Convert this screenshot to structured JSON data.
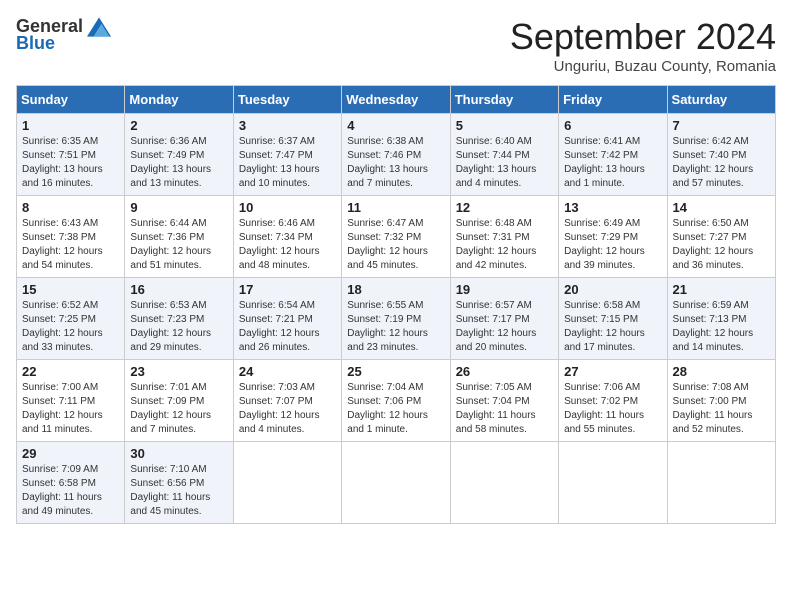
{
  "header": {
    "logo_general": "General",
    "logo_blue": "Blue",
    "month_title": "September 2024",
    "subtitle": "Unguriu, Buzau County, Romania"
  },
  "columns": [
    "Sunday",
    "Monday",
    "Tuesday",
    "Wednesday",
    "Thursday",
    "Friday",
    "Saturday"
  ],
  "weeks": [
    [
      {
        "day": "1",
        "sunrise": "Sunrise: 6:35 AM",
        "sunset": "Sunset: 7:51 PM",
        "daylight": "Daylight: 13 hours and 16 minutes."
      },
      {
        "day": "2",
        "sunrise": "Sunrise: 6:36 AM",
        "sunset": "Sunset: 7:49 PM",
        "daylight": "Daylight: 13 hours and 13 minutes."
      },
      {
        "day": "3",
        "sunrise": "Sunrise: 6:37 AM",
        "sunset": "Sunset: 7:47 PM",
        "daylight": "Daylight: 13 hours and 10 minutes."
      },
      {
        "day": "4",
        "sunrise": "Sunrise: 6:38 AM",
        "sunset": "Sunset: 7:46 PM",
        "daylight": "Daylight: 13 hours and 7 minutes."
      },
      {
        "day": "5",
        "sunrise": "Sunrise: 6:40 AM",
        "sunset": "Sunset: 7:44 PM",
        "daylight": "Daylight: 13 hours and 4 minutes."
      },
      {
        "day": "6",
        "sunrise": "Sunrise: 6:41 AM",
        "sunset": "Sunset: 7:42 PM",
        "daylight": "Daylight: 13 hours and 1 minute."
      },
      {
        "day": "7",
        "sunrise": "Sunrise: 6:42 AM",
        "sunset": "Sunset: 7:40 PM",
        "daylight": "Daylight: 12 hours and 57 minutes."
      }
    ],
    [
      {
        "day": "8",
        "sunrise": "Sunrise: 6:43 AM",
        "sunset": "Sunset: 7:38 PM",
        "daylight": "Daylight: 12 hours and 54 minutes."
      },
      {
        "day": "9",
        "sunrise": "Sunrise: 6:44 AM",
        "sunset": "Sunset: 7:36 PM",
        "daylight": "Daylight: 12 hours and 51 minutes."
      },
      {
        "day": "10",
        "sunrise": "Sunrise: 6:46 AM",
        "sunset": "Sunset: 7:34 PM",
        "daylight": "Daylight: 12 hours and 48 minutes."
      },
      {
        "day": "11",
        "sunrise": "Sunrise: 6:47 AM",
        "sunset": "Sunset: 7:32 PM",
        "daylight": "Daylight: 12 hours and 45 minutes."
      },
      {
        "day": "12",
        "sunrise": "Sunrise: 6:48 AM",
        "sunset": "Sunset: 7:31 PM",
        "daylight": "Daylight: 12 hours and 42 minutes."
      },
      {
        "day": "13",
        "sunrise": "Sunrise: 6:49 AM",
        "sunset": "Sunset: 7:29 PM",
        "daylight": "Daylight: 12 hours and 39 minutes."
      },
      {
        "day": "14",
        "sunrise": "Sunrise: 6:50 AM",
        "sunset": "Sunset: 7:27 PM",
        "daylight": "Daylight: 12 hours and 36 minutes."
      }
    ],
    [
      {
        "day": "15",
        "sunrise": "Sunrise: 6:52 AM",
        "sunset": "Sunset: 7:25 PM",
        "daylight": "Daylight: 12 hours and 33 minutes."
      },
      {
        "day": "16",
        "sunrise": "Sunrise: 6:53 AM",
        "sunset": "Sunset: 7:23 PM",
        "daylight": "Daylight: 12 hours and 29 minutes."
      },
      {
        "day": "17",
        "sunrise": "Sunrise: 6:54 AM",
        "sunset": "Sunset: 7:21 PM",
        "daylight": "Daylight: 12 hours and 26 minutes."
      },
      {
        "day": "18",
        "sunrise": "Sunrise: 6:55 AM",
        "sunset": "Sunset: 7:19 PM",
        "daylight": "Daylight: 12 hours and 23 minutes."
      },
      {
        "day": "19",
        "sunrise": "Sunrise: 6:57 AM",
        "sunset": "Sunset: 7:17 PM",
        "daylight": "Daylight: 12 hours and 20 minutes."
      },
      {
        "day": "20",
        "sunrise": "Sunrise: 6:58 AM",
        "sunset": "Sunset: 7:15 PM",
        "daylight": "Daylight: 12 hours and 17 minutes."
      },
      {
        "day": "21",
        "sunrise": "Sunrise: 6:59 AM",
        "sunset": "Sunset: 7:13 PM",
        "daylight": "Daylight: 12 hours and 14 minutes."
      }
    ],
    [
      {
        "day": "22",
        "sunrise": "Sunrise: 7:00 AM",
        "sunset": "Sunset: 7:11 PM",
        "daylight": "Daylight: 12 hours and 11 minutes."
      },
      {
        "day": "23",
        "sunrise": "Sunrise: 7:01 AM",
        "sunset": "Sunset: 7:09 PM",
        "daylight": "Daylight: 12 hours and 7 minutes."
      },
      {
        "day": "24",
        "sunrise": "Sunrise: 7:03 AM",
        "sunset": "Sunset: 7:07 PM",
        "daylight": "Daylight: 12 hours and 4 minutes."
      },
      {
        "day": "25",
        "sunrise": "Sunrise: 7:04 AM",
        "sunset": "Sunset: 7:06 PM",
        "daylight": "Daylight: 12 hours and 1 minute."
      },
      {
        "day": "26",
        "sunrise": "Sunrise: 7:05 AM",
        "sunset": "Sunset: 7:04 PM",
        "daylight": "Daylight: 11 hours and 58 minutes."
      },
      {
        "day": "27",
        "sunrise": "Sunrise: 7:06 AM",
        "sunset": "Sunset: 7:02 PM",
        "daylight": "Daylight: 11 hours and 55 minutes."
      },
      {
        "day": "28",
        "sunrise": "Sunrise: 7:08 AM",
        "sunset": "Sunset: 7:00 PM",
        "daylight": "Daylight: 11 hours and 52 minutes."
      }
    ],
    [
      {
        "day": "29",
        "sunrise": "Sunrise: 7:09 AM",
        "sunset": "Sunset: 6:58 PM",
        "daylight": "Daylight: 11 hours and 49 minutes."
      },
      {
        "day": "30",
        "sunrise": "Sunrise: 7:10 AM",
        "sunset": "Sunset: 6:56 PM",
        "daylight": "Daylight: 11 hours and 45 minutes."
      },
      null,
      null,
      null,
      null,
      null
    ]
  ]
}
